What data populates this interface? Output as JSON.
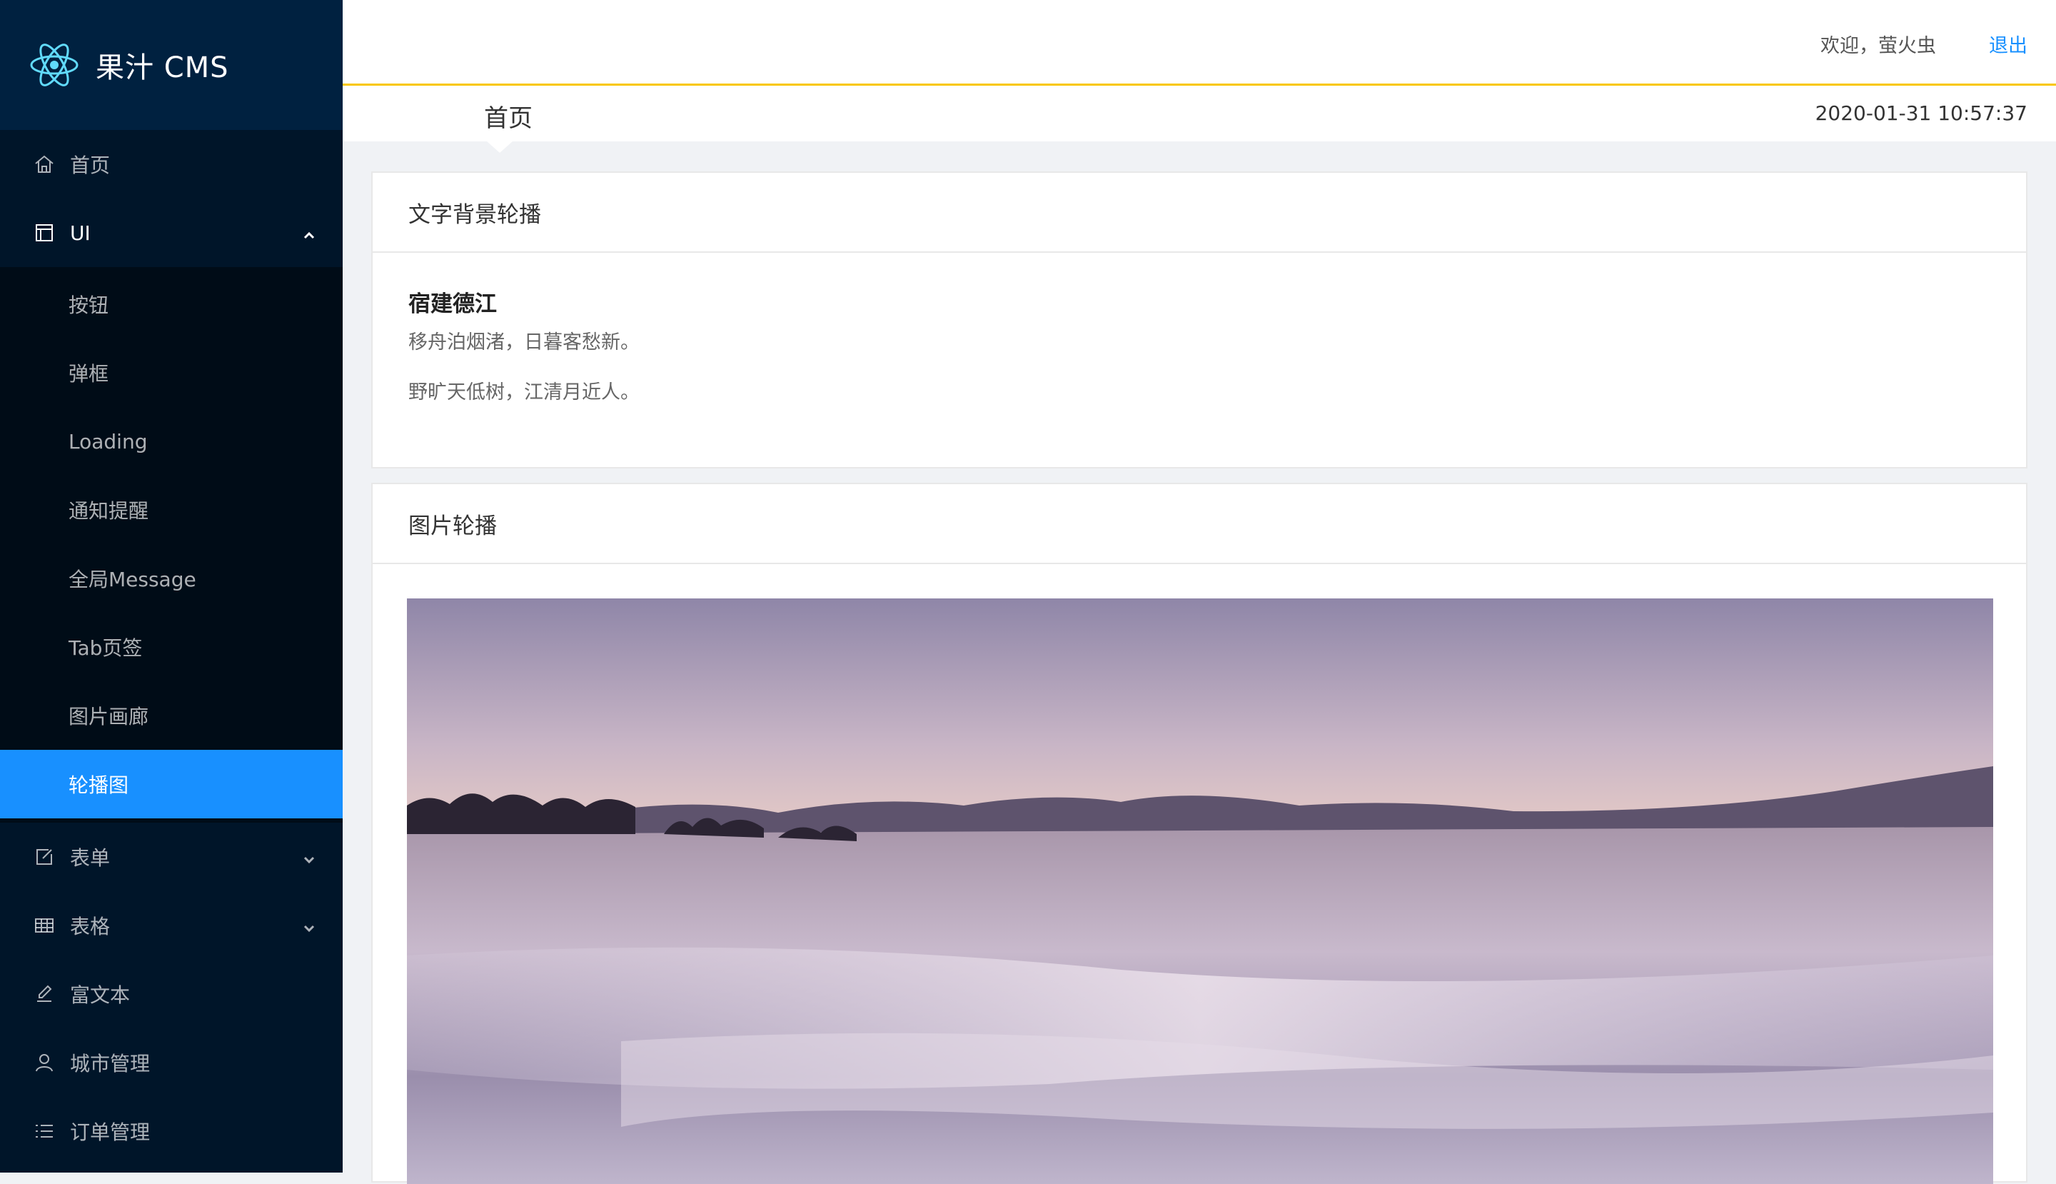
{
  "app": {
    "title": "果汁 CMS"
  },
  "sidebar": {
    "items": [
      {
        "label": "首页",
        "icon": "home-icon"
      },
      {
        "label": "UI",
        "icon": "layout-icon",
        "open": true,
        "children": [
          {
            "label": "按钮"
          },
          {
            "label": "弹框"
          },
          {
            "label": "Loading"
          },
          {
            "label": "通知提醒"
          },
          {
            "label": "全局Message"
          },
          {
            "label": "Tab页签"
          },
          {
            "label": "图片画廊"
          },
          {
            "label": "轮播图",
            "active": true
          }
        ]
      },
      {
        "label": "表单",
        "icon": "form-icon"
      },
      {
        "label": "表格",
        "icon": "table-icon"
      },
      {
        "label": "富文本",
        "icon": "edit-icon"
      },
      {
        "label": "城市管理",
        "icon": "user-icon"
      },
      {
        "label": "订单管理",
        "icon": "list-icon"
      }
    ]
  },
  "header": {
    "welcome": "欢迎，萤火虫",
    "logout": "退出"
  },
  "breadcrumb": {
    "title": "首页",
    "time": "2020-01-31 10:57:37"
  },
  "text_carousel": {
    "title": "文字背景轮播",
    "poem_title": "宿建德江",
    "lines": [
      "移舟泊烟渚，日暮客愁新。",
      "野旷天低树，江清月近人。"
    ]
  },
  "image_carousel": {
    "title": "图片轮播"
  },
  "colors": {
    "sidebar_bg": "#001529",
    "active": "#1890ff",
    "accent_border": "#f9c700"
  }
}
